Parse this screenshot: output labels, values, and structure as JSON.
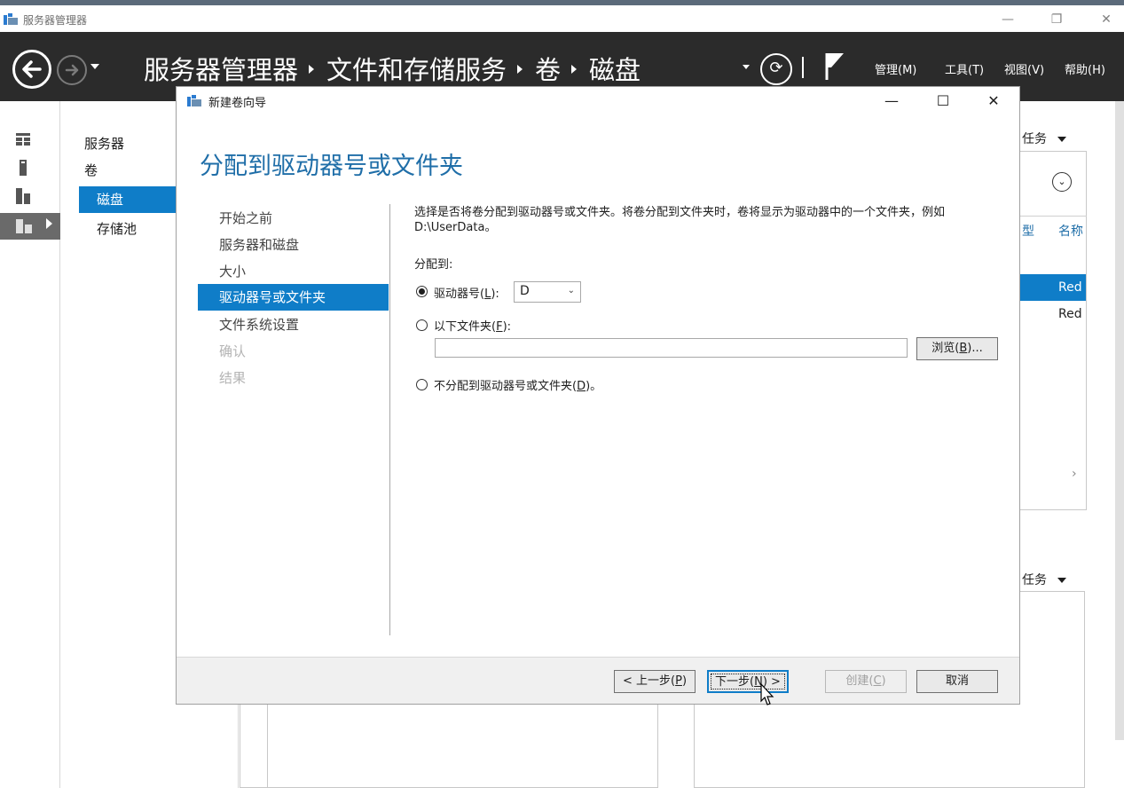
{
  "window": {
    "title": "服务器管理器",
    "controls": {
      "minimize": "—",
      "restore": "❐",
      "close": "✕"
    }
  },
  "navbar": {
    "breadcrumb": [
      "服务器管理器",
      "文件和存储服务",
      "卷",
      "磁盘"
    ],
    "menus": [
      "管理(M)",
      "工具(T)",
      "视图(V)",
      "帮助(H)"
    ]
  },
  "sidebar": {
    "items": [
      {
        "label": "服务器",
        "selected": false
      },
      {
        "label": "卷",
        "selected": false
      },
      {
        "label": "磁盘",
        "selected": true
      },
      {
        "label": "存储池",
        "selected": false
      }
    ]
  },
  "background": {
    "tasks_label": "任务",
    "col_type": "型",
    "col_name": "名称",
    "rows": [
      "Red",
      "Red"
    ],
    "chevron": "›"
  },
  "dialog": {
    "title": "新建卷向导",
    "controls": {
      "minimize": "—",
      "maximize": "☐",
      "close": "✕"
    },
    "heading": "分配到驱动器号或文件夹",
    "steps": [
      {
        "label": "开始之前",
        "state": "normal"
      },
      {
        "label": "服务器和磁盘",
        "state": "normal"
      },
      {
        "label": "大小",
        "state": "normal"
      },
      {
        "label": "驱动器号或文件夹",
        "state": "current"
      },
      {
        "label": "文件系统设置",
        "state": "normal"
      },
      {
        "label": "确认",
        "state": "disabled"
      },
      {
        "label": "结果",
        "state": "disabled"
      }
    ],
    "description": "选择是否将卷分配到驱动器号或文件夹。将卷分配到文件夹时，卷将显示为驱动器中的一个文件夹，例如 D:\\UserData。",
    "assign_to": "分配到:",
    "option_drive": {
      "prefix": "驱动器号(",
      "key": "L",
      "suffix": "):",
      "checked": true
    },
    "drive_value": "D",
    "option_folder": {
      "prefix": "以下文件夹(",
      "key": "F",
      "suffix": "):",
      "checked": false
    },
    "folder_value": "",
    "browse": {
      "prefix": "浏览(",
      "key": "B",
      "suffix": ")..."
    },
    "option_none": {
      "prefix": "不分配到驱动器号或文件夹(",
      "key": "D",
      "suffix": ")。",
      "checked": false
    },
    "buttons": {
      "back": {
        "prefix": "< 上一步(",
        "key": "P",
        "suffix": ")"
      },
      "next": {
        "prefix": "下一步(",
        "key": "N",
        "suffix": ") >"
      },
      "create": {
        "prefix": "创建(",
        "key": "C",
        "suffix": ")"
      },
      "cancel": "取消"
    }
  }
}
